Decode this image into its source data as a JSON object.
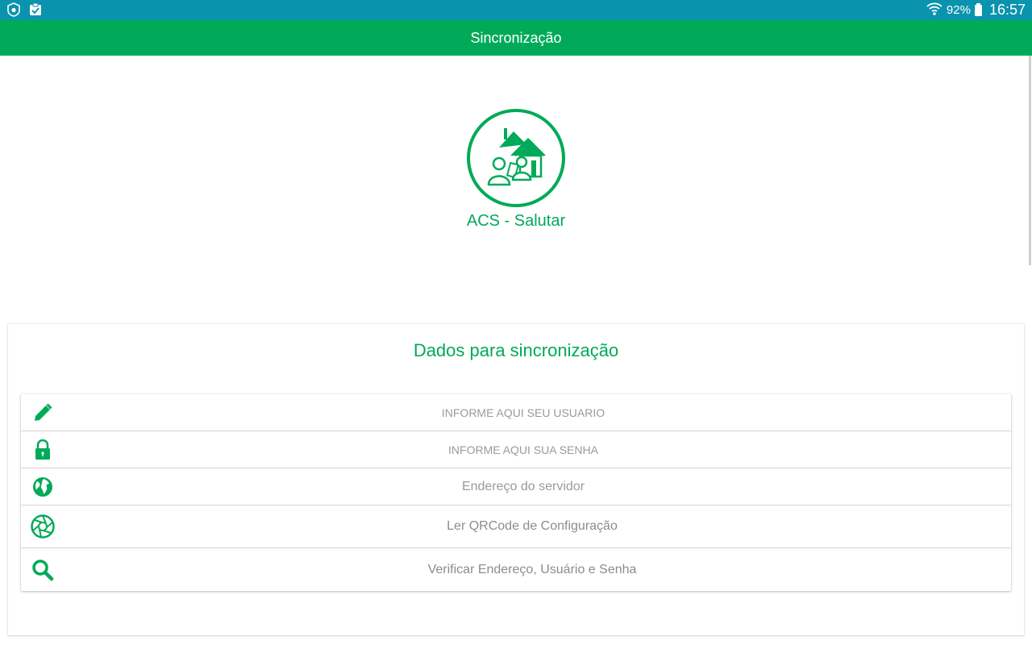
{
  "status_bar": {
    "battery_percent": "92%",
    "time": "16:57",
    "left_icons": [
      "shield-icon",
      "clipboard-check-icon"
    ],
    "right_icons": [
      "wifi-icon",
      "battery-icon"
    ]
  },
  "app_bar": {
    "title": "Sincronização"
  },
  "logo": {
    "app_name": "ACS - Salutar"
  },
  "form": {
    "title": "Dados para sincronização",
    "username": {
      "placeholder": "INFORME AQUI SEU USUARIO",
      "value": "",
      "icon": "pencil-icon"
    },
    "password": {
      "placeholder": "INFORME AQUI SUA SENHA",
      "value": "",
      "icon": "lock-icon"
    },
    "server": {
      "placeholder": "Endereço do servidor",
      "value": "",
      "icon": "globe-icon"
    },
    "qrcode_button": {
      "label": "Ler QRCode de Configuração",
      "icon": "aperture-icon"
    },
    "verify_button": {
      "label": "Verificar Endereço, Usuário e Senha",
      "icon": "search-icon"
    }
  },
  "colors": {
    "status_bar": "#0a93ad",
    "primary": "#00aa58",
    "text_muted": "#9a9a9a"
  }
}
